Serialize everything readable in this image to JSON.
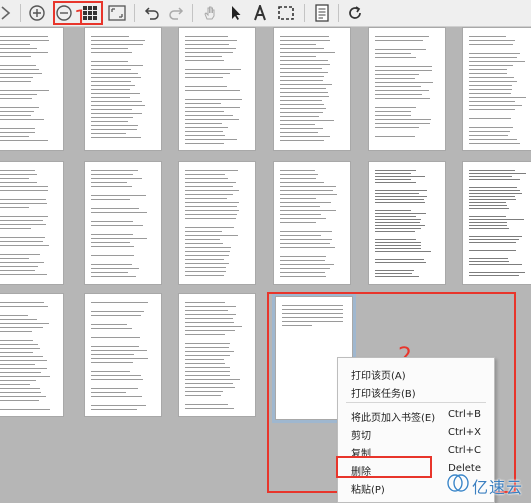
{
  "toolbar": {
    "icons": [
      "forward-arrow-icon",
      "zoom-in-icon",
      "zoom-out-icon",
      "thumbnail-grid-icon",
      "fit-page-icon",
      "undo-icon",
      "redo-icon",
      "hand-tool-icon",
      "select-arrow-icon",
      "text-tool-icon",
      "marquee-select-icon",
      "document-icon",
      "refresh-icon"
    ]
  },
  "annotations": {
    "step1": "1",
    "step2": "2"
  },
  "context_menu": {
    "items": [
      {
        "label": "打印该页(A)",
        "shortcut": ""
      },
      {
        "label": "打印该任务(B)",
        "shortcut": ""
      },
      {
        "label": "将此页加入书签(E)",
        "shortcut": "Ctrl+B"
      },
      {
        "label": "剪切",
        "shortcut": "Ctrl+X"
      },
      {
        "label": "复制",
        "shortcut": "Ctrl+C"
      },
      {
        "label": "删除",
        "shortcut": "Delete"
      },
      {
        "label": "粘贴(P)",
        "shortcut": ""
      }
    ]
  },
  "watermark": {
    "text": "亿速云"
  },
  "colors": {
    "highlight": "#e8352b",
    "toolbar_bg": "#efefef",
    "canvas_bg": "#b6b6b6",
    "selected_page": "#9fb7cf"
  }
}
